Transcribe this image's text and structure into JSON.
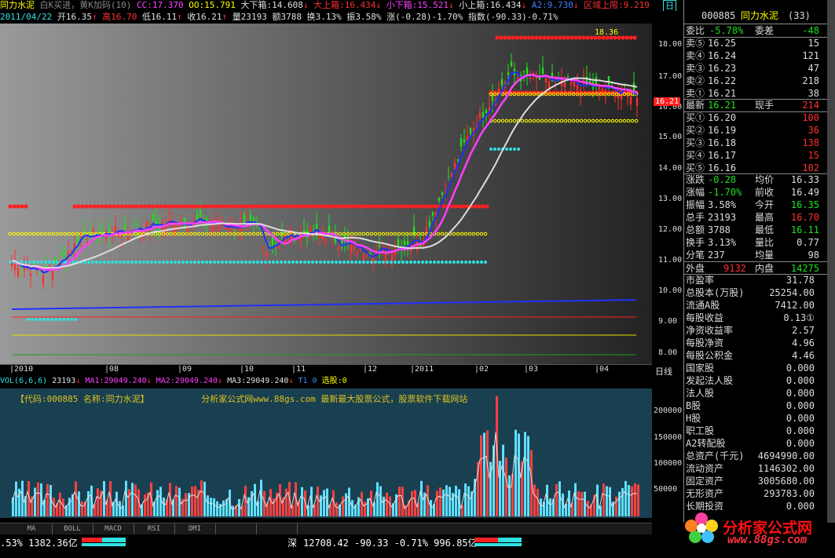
{
  "header1": {
    "stock_name": "同力水泥",
    "signal_text": "白K买进，黄K加码(10)",
    "cc": "CC:17.370",
    "oo": "OO:15.791",
    "big_down": "大下箱:14.608",
    "big_up": "大上箱:16.434",
    "small_down": "小下箱:15.521",
    "small_up": "小上箱:16.434",
    "a2": "A2:9.730",
    "limit": "区域上限:9.219",
    "right_icon": "日"
  },
  "header2": {
    "date": "2011/04/22",
    "open": "开16.35",
    "high": "高16.70",
    "low": "低16.11",
    "close": "收16.21",
    "vol": "量23193",
    "amount": "额3788",
    "turnover": "换3.13%",
    "amplitude": "振3.58%",
    "change": "涨(-0.28)-1.70%",
    "index": "指数(-90.33)-0.71%"
  },
  "price_axis": [
    "18.00",
    "17.00",
    "16.00",
    "15.00",
    "14.00",
    "13.00",
    "12.00",
    "11.00",
    "10.00",
    "9.00",
    "8.00"
  ],
  "price_axis_unit": "日线",
  "current_price_tag": "16.21",
  "peak_label": "18.36",
  "volume_axis": [
    "200000",
    "150000",
    "100000",
    "50000"
  ],
  "date_ticks": [
    "2010",
    "08",
    "09",
    "10",
    "11",
    "12",
    "2011",
    "02",
    "03",
    "04"
  ],
  "vol_header": {
    "name": "VOL(6,6,6)",
    "value": "23193",
    "ma1": "MA1:29049.240",
    "ma2": "MA2:29049.240",
    "ma3": "MA3:29049.240",
    "t1": "T1 0",
    "pick": "选股:0"
  },
  "vol_banner": {
    "code": "【代码:000885 名称:同力水泥】",
    "ad": "分析家公式网www.88gs.com 最新最大股票公式，股票软件下载网站"
  },
  "tabs": [
    "MA",
    "BOLL",
    "MACD",
    "RSI",
    "DMI",
    "",
    ""
  ],
  "status": {
    "left": ".53% 1382.36亿",
    "mid_label": "深",
    "mid": "12708.42 -90.33 -0.71% 996.85亿"
  },
  "quote": {
    "code": "000885",
    "name": "同力水泥",
    "count": "(33)",
    "weibi_label": "委比",
    "weibi": "-5.78%",
    "weicha_label": "委差",
    "weicha": "-48",
    "sells": [
      {
        "label": "卖⑤",
        "price": "16.25",
        "vol": "15"
      },
      {
        "label": "卖④",
        "price": "16.24",
        "vol": "121"
      },
      {
        "label": "卖③",
        "price": "16.23",
        "vol": "47"
      },
      {
        "label": "卖②",
        "price": "16.22",
        "vol": "218"
      },
      {
        "label": "卖①",
        "price": "16.21",
        "vol": "38"
      }
    ],
    "last_label": "最新",
    "last": "16.21",
    "cur_label": "现手",
    "cur": "214",
    "buys": [
      {
        "label": "买①",
        "price": "16.20",
        "vol": "100"
      },
      {
        "label": "买②",
        "price": "16.19",
        "vol": "36"
      },
      {
        "label": "买③",
        "price": "16.18",
        "vol": "138"
      },
      {
        "label": "买④",
        "price": "16.17",
        "vol": "15"
      },
      {
        "label": "买⑤",
        "price": "16.16",
        "vol": "102"
      }
    ],
    "stats": [
      {
        "l1": "涨跌",
        "v1": "-0.28",
        "l2": "均价",
        "v2": "16.33",
        "c1": "#20e020",
        "c2": "#ddd"
      },
      {
        "l1": "涨幅",
        "v1": "-1.70%",
        "l2": "前收",
        "v2": "16.49",
        "c1": "#20e020",
        "c2": "#ddd"
      },
      {
        "l1": "振幅",
        "v1": "3.58%",
        "l2": "今开",
        "v2": "16.35",
        "c1": "#ddd",
        "c2": "#20e020"
      },
      {
        "l1": "总手",
        "v1": "23193",
        "l2": "最高",
        "v2": "16.70",
        "c1": "#ddd",
        "c2": "#ff3030"
      },
      {
        "l1": "总额",
        "v1": "3788",
        "l2": "最低",
        "v2": "16.11",
        "c1": "#ddd",
        "c2": "#20e020"
      },
      {
        "l1": "换手",
        "v1": "3.13%",
        "l2": "量比",
        "v2": "0.77",
        "c1": "#ddd",
        "c2": "#ddd"
      },
      {
        "l1": "分笔",
        "v1": "237",
        "l2": "均量",
        "v2": "98",
        "c1": "#ddd",
        "c2": "#ddd"
      }
    ],
    "outer_label": "外盘",
    "outer": "9132",
    "inner_label": "内盘",
    "inner": "14275"
  },
  "finance": [
    {
      "l": "市盈率",
      "v": "31.78"
    },
    {
      "l": "总股本(万股)",
      "v": "25254.00"
    },
    {
      "l": "流通A股",
      "v": "7412.00"
    },
    {
      "l": "每股收益",
      "v": "0.13①"
    },
    {
      "l": "净资收益率",
      "v": "2.57"
    },
    {
      "l": "每股净资",
      "v": "4.96"
    },
    {
      "l": "每股公积金",
      "v": "4.46"
    },
    {
      "l": "国家股",
      "v": "0.000"
    },
    {
      "l": "发起法人股",
      "v": "0.000"
    },
    {
      "l": "法人股",
      "v": "0.000"
    },
    {
      "l": "B股",
      "v": "0.000"
    },
    {
      "l": "H股",
      "v": "0.000"
    },
    {
      "l": "职工股",
      "v": "0.000"
    },
    {
      "l": "A2转配股",
      "v": "0.000"
    },
    {
      "l": "总资产(千元)",
      "v": "4694990.00"
    },
    {
      "l": "流动资产",
      "v": "1146302.00"
    },
    {
      "l": "固定资产",
      "v": "3005680.00"
    },
    {
      "l": "无形资产",
      "v": "293783.00"
    },
    {
      "l": "长期投资",
      "v": "0.000"
    }
  ],
  "logo": {
    "title": "分析家公式网",
    "url": "www.88gs.com"
  },
  "colors": {
    "up": "#ff3030",
    "down": "#20e020",
    "yellow": "#ffff00",
    "cyan": "#30e0e0",
    "magenta": "#ff40ff",
    "blue": "#2030ff"
  }
}
